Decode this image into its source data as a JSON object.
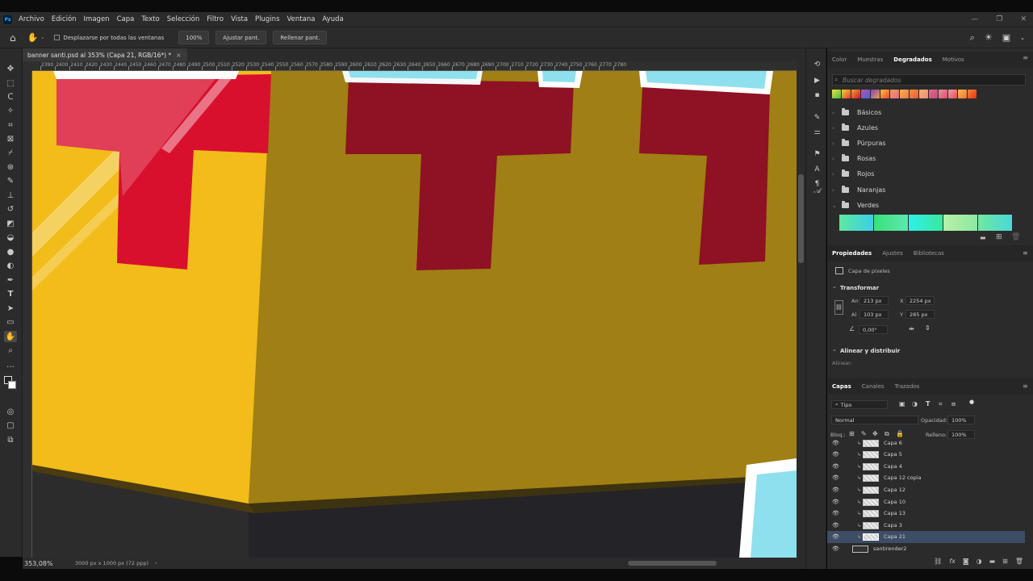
{
  "app": {
    "logo": "Ps",
    "menu": [
      "Archivo",
      "Edición",
      "Imagen",
      "Capa",
      "Texto",
      "Selección",
      "Filtro",
      "Vista",
      "Plugins",
      "Ventana",
      "Ayuda"
    ],
    "window_controls": [
      "—",
      "❐",
      "✕"
    ]
  },
  "options_bar": {
    "scroll_all_label": "Desplazarse por todas las ventanas",
    "zoom_btn": "100%",
    "fit_btn": "Ajustar pant.",
    "fill_btn": "Rellenar pant."
  },
  "document": {
    "tab_title": "banner santi.psd al 353% (Capa 21, RGB/16*) *",
    "tab_close": "×",
    "zoom": "353,08%",
    "info": "3000 px x 1000 px (72 ppp)"
  },
  "ruler": {
    "ticks": [
      "2390",
      "2400",
      "2410",
      "2420",
      "2430",
      "2440",
      "2450",
      "2460",
      "2470",
      "2480",
      "2490",
      "2500",
      "2510",
      "2520",
      "2530",
      "2540",
      "2550",
      "2560",
      "2570",
      "2580",
      "2590",
      "2600",
      "2610",
      "2620",
      "2630",
      "2640",
      "2650",
      "2660",
      "2670",
      "2680",
      "2690",
      "2700",
      "2710",
      "2720",
      "2730",
      "2740",
      "2750",
      "2760",
      "2770",
      "2780"
    ]
  },
  "panels": {
    "top_tabs": [
      "Color",
      "Muestras",
      "Degradados",
      "Motivos"
    ],
    "top_active": "Degradados",
    "search_placeholder": "Buscar degradados",
    "gradient_folders": [
      "Básicos",
      "Azules",
      "Púrpuras",
      "Rosas",
      "Rojos",
      "Naranjas",
      "Verdes"
    ],
    "properties_tabs": [
      "Propiedades",
      "Ajustes",
      "Bibliotecas"
    ],
    "properties_active": "Propiedades",
    "pixel_layer": "Capa de píxeles",
    "transform_title": "Transformar",
    "fields": {
      "w_label": "An",
      "w": "213 px",
      "h_label": "Al",
      "h": "103 px",
      "x_label": "X",
      "x": "2254 px",
      "y_label": "Y",
      "y": "285 px",
      "angle": "0,00°"
    },
    "align_title": "Alinear y distribuir",
    "align_label": "Alinear:",
    "layers_tabs": [
      "Capas",
      "Canales",
      "Trazados"
    ],
    "layers_active": "Capas",
    "filter_kind": "Tipo",
    "blend_mode": "Normal",
    "opacity_label": "Opacidad:",
    "opacity": "100%",
    "lock_label": "Bloq.:",
    "fill_label": "Relleno:",
    "fill": "100%",
    "layers": [
      "Capa 6",
      "Capa 5",
      "Capa 4",
      "Capa 12 copia",
      "Capa 12",
      "Capa 10",
      "Capa 13",
      "Capa 3",
      "Capa 21",
      "santirender2"
    ],
    "selected_layer": "Capa 21"
  },
  "colors": {
    "ui_bg": "#2b2b2b",
    "selection": "#3d4d66",
    "box_dark": "#a07f14",
    "box_light": "#f2bc1a",
    "red_dark": "#8e1124",
    "red_light": "#d8102e",
    "cyan": "#8fe0ee"
  }
}
